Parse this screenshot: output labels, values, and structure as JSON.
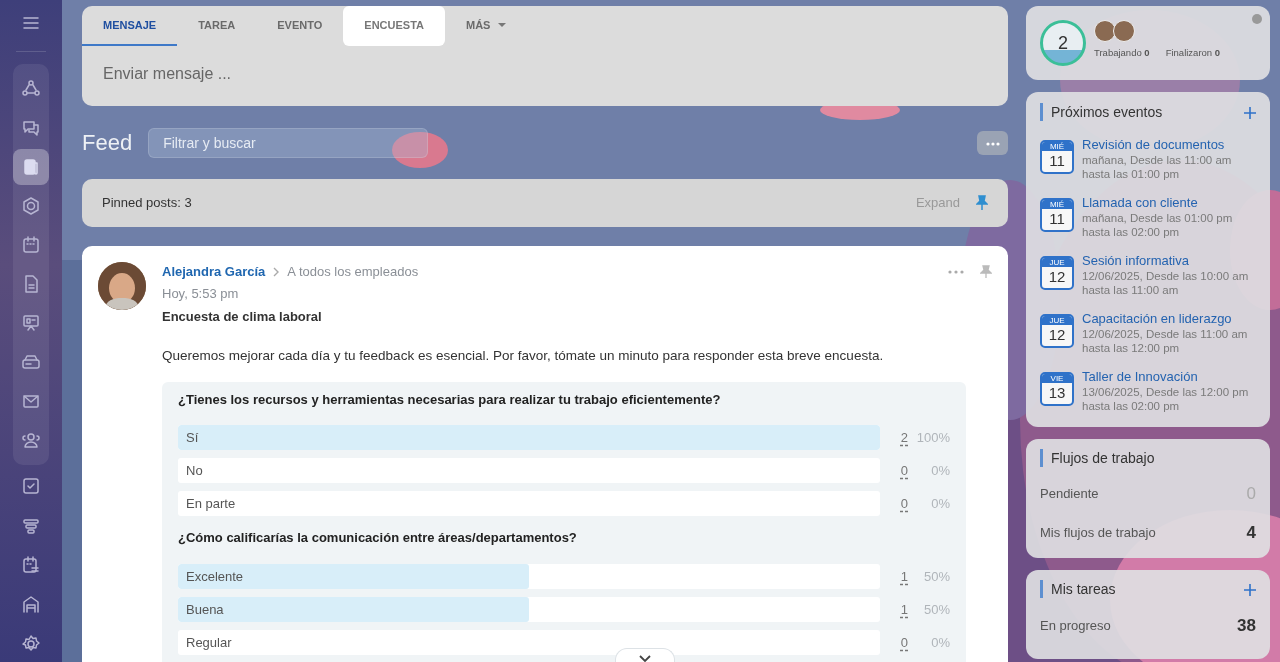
{
  "sidebar": {
    "items": [
      {
        "selected": false
      },
      {
        "selected": false
      },
      {
        "selected": true
      },
      {
        "selected": false
      },
      {
        "selected": false
      },
      {
        "selected": false
      },
      {
        "selected": false
      },
      {
        "selected": false
      },
      {
        "selected": false
      },
      {
        "selected": false
      },
      {
        "selected": false
      },
      {
        "selected": false
      },
      {
        "selected": false
      },
      {
        "selected": false
      },
      {
        "selected": false
      }
    ]
  },
  "composer": {
    "tabs": [
      {
        "label": "MENSAJE",
        "selected": true,
        "highlighted": false,
        "kind": "tab"
      },
      {
        "label": "TAREA",
        "selected": false,
        "highlighted": false,
        "kind": "tab"
      },
      {
        "label": "EVENTO",
        "selected": false,
        "highlighted": false,
        "kind": "tab"
      },
      {
        "label": "ENCUESTA",
        "selected": false,
        "highlighted": true,
        "kind": "tab"
      },
      {
        "label": "MÁS",
        "selected": false,
        "highlighted": false,
        "kind": "dropdown"
      }
    ],
    "placeholder": "Enviar mensaje ..."
  },
  "feed": {
    "title": "Feed",
    "search": {
      "placeholder": "Filtrar y buscar"
    }
  },
  "pinned": {
    "label": "Pinned posts: 3",
    "action": "Expand"
  },
  "post": {
    "author": "Alejandra García",
    "recipient": "A todos los empleados",
    "time": "Hoy, 5:53 pm",
    "title": "Encuesta de clima laboral",
    "body": "Queremos mejorar cada día y tu feedback es esencial. Por favor, tómate un minuto para responder esta breve encuesta.",
    "polls": [
      {
        "question": "¿Tienes los recursos y herramientas necesarias para realizar tu trabajo eficientemente?",
        "answers": [
          {
            "label": "Sí",
            "count": "2",
            "percent": "100%",
            "level": 1
          },
          {
            "label": "No",
            "count": "0",
            "percent": "0%",
            "level": 0
          },
          {
            "label": "En parte",
            "count": "0",
            "percent": "0%",
            "level": 0
          }
        ]
      },
      {
        "question": "¿Cómo calificarías la comunicación entre áreas/departamentos?",
        "answers": [
          {
            "label": "Excelente",
            "count": "1",
            "percent": "50%",
            "level": 0.5
          },
          {
            "label": "Buena",
            "count": "1",
            "percent": "50%",
            "level": 0.5
          },
          {
            "label": "Regular",
            "count": "0",
            "percent": "0%",
            "level": 0
          }
        ]
      }
    ]
  },
  "presence": {
    "count": "2",
    "stats": [
      {
        "label": "Trabajando",
        "value": "0"
      },
      {
        "label": "Finalizaron",
        "value": "0"
      }
    ]
  },
  "events": {
    "title": "Próximos eventos",
    "items": [
      {
        "weekday": "MIÉ",
        "day": "11",
        "title": "Revisión de documentos",
        "when": "mañana, Desde las 11:00 am",
        "until": "hasta las 01:00 pm"
      },
      {
        "weekday": "MIÉ",
        "day": "11",
        "title": "Llamada con cliente",
        "when": "mañana, Desde las 01:00 pm",
        "until": "hasta las 02:00 pm"
      },
      {
        "weekday": "JUE",
        "day": "12",
        "title": "Sesión informativa",
        "when": "12/06/2025, Desde las 10:00 am",
        "until": "hasta las 11:00 am"
      },
      {
        "weekday": "JUE",
        "day": "12",
        "title": "Capacitación en liderazgo",
        "when": "12/06/2025, Desde las 11:00 am",
        "until": "hasta las 12:00 pm"
      },
      {
        "weekday": "VIE",
        "day": "13",
        "title": "Taller de Innovación",
        "when": "13/06/2025, Desde las 12:00 pm",
        "until": "hasta las 02:00 pm"
      }
    ]
  },
  "workflows": {
    "title": "Flujos de trabajo",
    "rows": [
      {
        "label": "Pendiente",
        "value": "0",
        "muted": true
      },
      {
        "label": "Mis flujos de trabajo",
        "value": "4",
        "muted": false
      }
    ]
  },
  "tasks": {
    "title": "Mis tareas",
    "rows": [
      {
        "label": "En progreso",
        "value": "38",
        "muted": false
      }
    ]
  }
}
